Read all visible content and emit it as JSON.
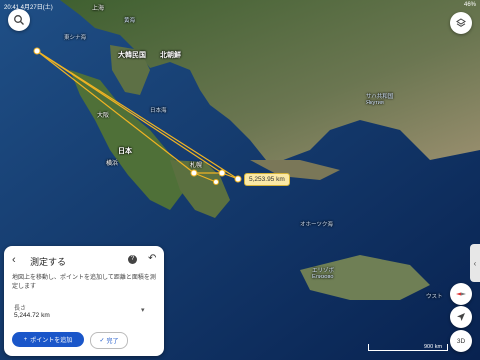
{
  "status": {
    "time_date": "20:41  4月27日(土)",
    "right": "46%"
  },
  "map": {
    "labels": {
      "kita_korea": "北朝鮮",
      "korea": "大韓民国",
      "japan": "日本",
      "osaka": "大阪",
      "yokohama": "横浜",
      "sapporo": "札幌",
      "japan_sea": "日本海",
      "okhotsk": "オホーツク海",
      "east_china_sea": "東シナ海",
      "yellow_sea": "黄海",
      "sakha": "サハ共和国\nЯкутия",
      "left_top": "上海",
      "small_label": "エリゾボ\nЕлизово",
      "kamchatka": "ウスト"
    }
  },
  "measurement": {
    "distance_badge": "5,253.95 km"
  },
  "panel": {
    "title": "測定する",
    "help": "?",
    "description": "地図上を移動し、ポイントを追加して距離と面積を測定します",
    "length_label": "長さ",
    "length_value": "5,244.72 km",
    "add_point": "ポイントを追加",
    "done": "完了"
  },
  "controls": {
    "mode_3d": "3D",
    "scale_text": "900 km"
  },
  "colors": {
    "route": "#f0b323",
    "accent": "#1a56c9"
  },
  "icons": [
    "search-icon",
    "layers-icon",
    "back-icon",
    "help-icon",
    "undo-icon",
    "menu-icon",
    "plus-icon",
    "check-icon",
    "compass-icon",
    "location-arrow-icon",
    "side-tab-icon"
  ]
}
